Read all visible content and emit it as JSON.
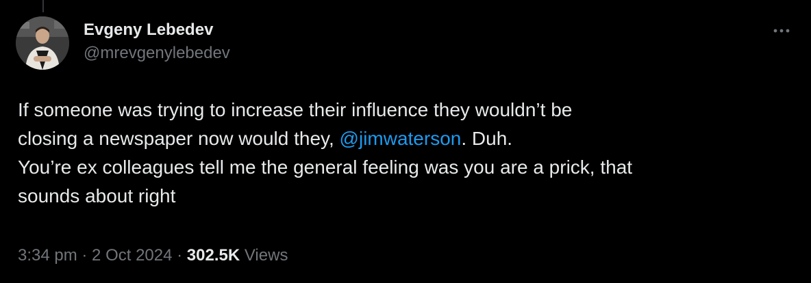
{
  "author": {
    "display_name": "Evgeny Lebedev",
    "handle": "@mrevgenylebedev",
    "avatar_icon": "profile-photo"
  },
  "more_icon": "more-horizontal-icon",
  "tweet": {
    "line1": "If someone was trying to increase their influence they wouldn’t be",
    "line2_before": "closing a newspaper now would they, ",
    "mention": "@jimwaterson",
    "line2_after": ". Duh.",
    "line3": "You’re ex colleagues tell me the general feeling was you are a prick, that",
    "line4": "sounds about right"
  },
  "meta": {
    "time": "3:34 pm",
    "separator1": " · ",
    "date": "2 Oct 2024",
    "separator2": " · ",
    "views_count": "302.5K",
    "views_label": " Views"
  },
  "colors": {
    "background": "#000000",
    "text_primary": "#e7e9ea",
    "text_secondary": "#71767b",
    "link": "#1d9bf0"
  }
}
